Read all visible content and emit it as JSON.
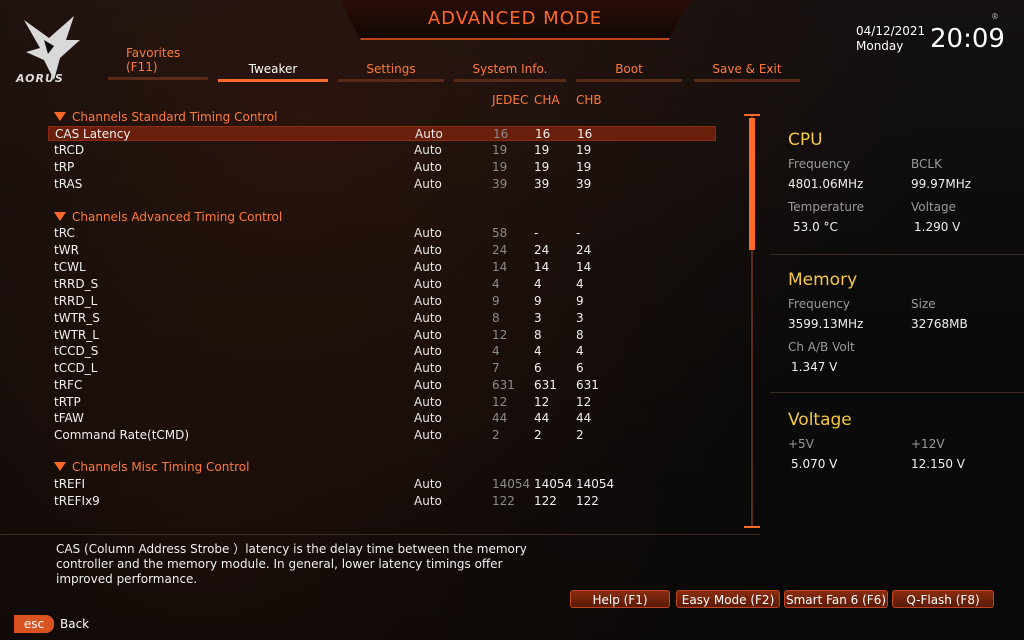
{
  "header": {
    "mode_title": "ADVANCED MODE",
    "logo_text": "AORUS",
    "date": "04/12/2021",
    "day": "Monday",
    "time": "20:09",
    "reg_mark": "®"
  },
  "tabs": [
    {
      "label": "Favorites",
      "sub": "(F11)"
    },
    {
      "label": "Tweaker"
    },
    {
      "label": "Settings"
    },
    {
      "label": "System Info."
    },
    {
      "label": "Boot"
    },
    {
      "label": "Save & Exit"
    }
  ],
  "columns": {
    "jedec": "JEDEC",
    "cha": "CHA",
    "chb": "CHB"
  },
  "sections": [
    {
      "title": "Channels Standard Timing Control"
    },
    {
      "title": "Channels Advanced Timing Control"
    },
    {
      "title": "Channels Misc Timing Control"
    }
  ],
  "rows": [
    {
      "name": "CAS Latency",
      "setting": "Auto",
      "jedec": "16",
      "cha": "16",
      "chb": "16"
    },
    {
      "name": "tRCD",
      "setting": "Auto",
      "jedec": "19",
      "cha": "19",
      "chb": "19"
    },
    {
      "name": "tRP",
      "setting": "Auto",
      "jedec": "19",
      "cha": "19",
      "chb": "19"
    },
    {
      "name": "tRAS",
      "setting": "Auto",
      "jedec": "39",
      "cha": "39",
      "chb": "39"
    },
    {
      "name": "tRC",
      "setting": "Auto",
      "jedec": "58",
      "cha": "-",
      "chb": "-"
    },
    {
      "name": "tWR",
      "setting": "Auto",
      "jedec": "24",
      "cha": "24",
      "chb": "24"
    },
    {
      "name": "tCWL",
      "setting": "Auto",
      "jedec": "14",
      "cha": "14",
      "chb": "14"
    },
    {
      "name": "tRRD_S",
      "setting": "Auto",
      "jedec": "4",
      "cha": "4",
      "chb": "4"
    },
    {
      "name": "tRRD_L",
      "setting": "Auto",
      "jedec": "9",
      "cha": "9",
      "chb": "9"
    },
    {
      "name": "tWTR_S",
      "setting": "Auto",
      "jedec": "8",
      "cha": "3",
      "chb": "3"
    },
    {
      "name": "tWTR_L",
      "setting": "Auto",
      "jedec": "12",
      "cha": "8",
      "chb": "8"
    },
    {
      "name": "tCCD_S",
      "setting": "Auto",
      "jedec": "4",
      "cha": "4",
      "chb": "4"
    },
    {
      "name": "tCCD_L",
      "setting": "Auto",
      "jedec": "7",
      "cha": "6",
      "chb": "6"
    },
    {
      "name": "tRFC",
      "setting": "Auto",
      "jedec": "631",
      "cha": "631",
      "chb": "631"
    },
    {
      "name": "tRTP",
      "setting": "Auto",
      "jedec": "12",
      "cha": "12",
      "chb": "12"
    },
    {
      "name": "tFAW",
      "setting": "Auto",
      "jedec": "44",
      "cha": "44",
      "chb": "44"
    },
    {
      "name": "Command Rate(tCMD)",
      "setting": "Auto",
      "jedec": "2",
      "cha": "2",
      "chb": "2"
    },
    {
      "name": "tREFI",
      "setting": "Auto",
      "jedec": "14054",
      "cha": "14054",
      "chb": "14054"
    },
    {
      "name": "tREFIx9",
      "setting": "Auto",
      "jedec": "122",
      "cha": "122",
      "chb": "122"
    }
  ],
  "panel": {
    "cpu": {
      "title": "CPU",
      "freq_label": "Frequency",
      "freq": "4801.06MHz",
      "bclk_label": "BCLK",
      "bclk": "99.97MHz",
      "temp_label": "Temperature",
      "temp": "53.0 °C",
      "volt_label": "Voltage",
      "volt": "1.290 V"
    },
    "memory": {
      "title": "Memory",
      "freq_label": "Frequency",
      "freq": "3599.13MHz",
      "size_label": "Size",
      "size": "32768MB",
      "volt_label": "Ch A/B Volt",
      "volt": "1.347 V"
    },
    "voltage": {
      "title": "Voltage",
      "v5_label": "+5V",
      "v5": "5.070 V",
      "v12_label": "+12V",
      "v12": "12.150 V"
    }
  },
  "description": "CAS (Column Address Strobe ）latency is the delay time between the memory controller and the memory module. In general, lower latency timings offer improved performance.",
  "buttons": {
    "help": "Help (F1)",
    "easy": "Easy Mode (F2)",
    "fan": "Smart Fan 6 (F6)",
    "qflash": "Q-Flash (F8)"
  },
  "footer": {
    "esc": "esc",
    "back": "Back"
  },
  "colors": {
    "accent": "#ff6a2b",
    "section_title": "#f5c742",
    "selected_row": "#6a1e0c"
  }
}
